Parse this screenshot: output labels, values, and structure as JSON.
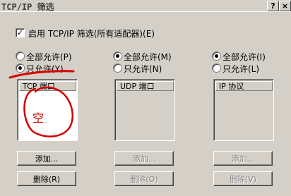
{
  "window": {
    "title": "TCP/IP 筛选",
    "help_label": "?",
    "close_label": "×"
  },
  "enable_filter": {
    "label": "启用 TCP/IP 筛选(所有适配器)(E)",
    "checked": true
  },
  "columns": [
    {
      "permit_all_label": "全部允许(P)",
      "permit_only_label": "只允许(Y)",
      "selected": "permit_only",
      "list_header": "TCP 端口",
      "list_items": [],
      "add_label": "添加...",
      "remove_label": "删除(R)",
      "buttons_enabled": true
    },
    {
      "permit_all_label": "全部允许(M)",
      "permit_only_label": "只允许(N)",
      "selected": "permit_all",
      "list_header": "UDP 端口",
      "list_items": [],
      "add_label": "添加...",
      "remove_label": "删除(O)",
      "buttons_enabled": false
    },
    {
      "permit_all_label": "全部允许(I)",
      "permit_only_label": "只允许(L)",
      "selected": "permit_all",
      "list_header": "IP 协议",
      "list_items": [],
      "add_label": "添加...",
      "remove_label": "删除(V)",
      "buttons_enabled": false
    }
  ],
  "annotation": {
    "handwritten_text": "空",
    "color": "#d40000"
  }
}
